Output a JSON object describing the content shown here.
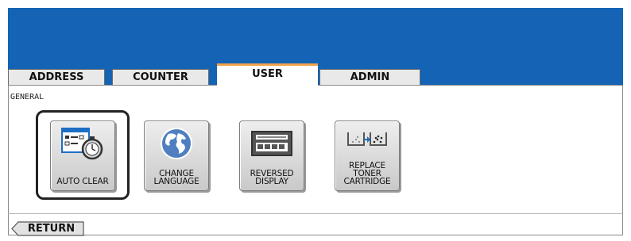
{
  "tabs": [
    {
      "label": "ADDRESS",
      "active": false
    },
    {
      "label": "COUNTER",
      "active": false
    },
    {
      "label": "USER",
      "active": true
    },
    {
      "label": "ADMIN",
      "active": false
    }
  ],
  "section": {
    "label": "GENERAL"
  },
  "buttons": [
    {
      "label": "AUTO CLEAR",
      "icon": "auto-clear-timer-icon",
      "selected": true
    },
    {
      "label": "CHANGE\nLANGUAGE",
      "icon": "globe-icon",
      "selected": false
    },
    {
      "label": "REVERSED\nDISPLAY",
      "icon": "reversed-display-icon",
      "selected": false
    },
    {
      "label": "REPLACE\nTONER\nCARTRIDGE",
      "icon": "toner-cartridge-icon",
      "selected": false
    }
  ],
  "footer": {
    "return_label": "RETURN"
  },
  "colors": {
    "banner": "#1463b5",
    "active_tab_accent": "#f2a24a"
  }
}
